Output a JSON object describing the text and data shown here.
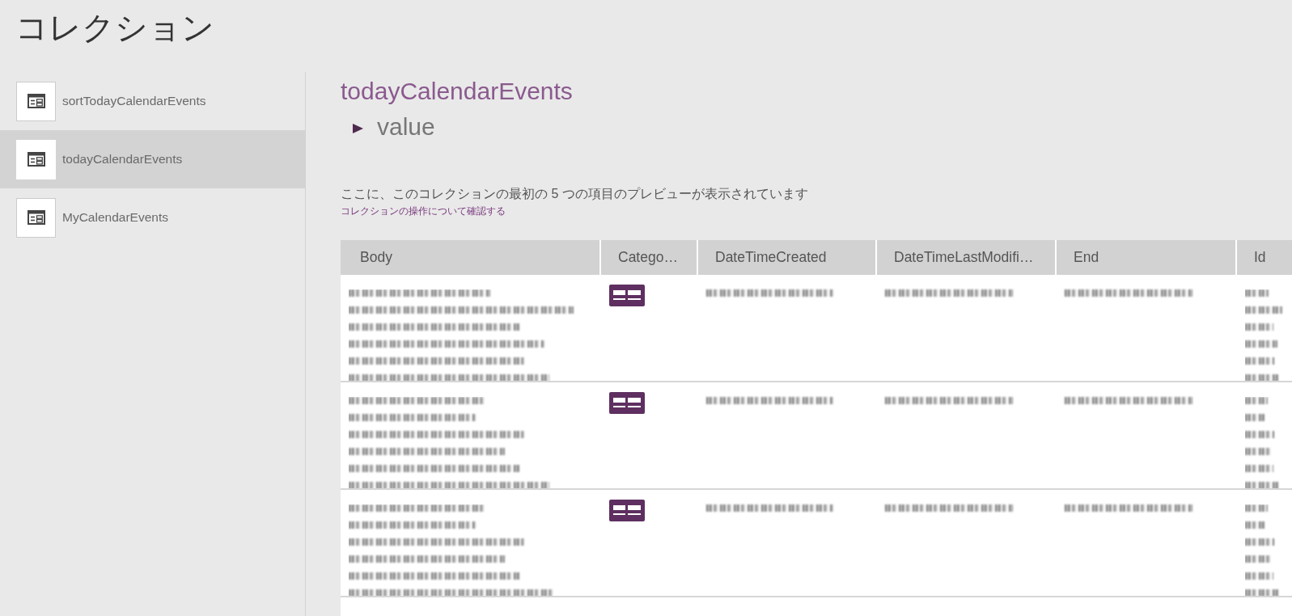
{
  "page_title": "コレクション",
  "sidebar": {
    "items": [
      {
        "label": "sortTodayCalendarEvents",
        "selected": false
      },
      {
        "label": "todayCalendarEvents",
        "selected": true
      },
      {
        "label": "MyCalendarEvents",
        "selected": false
      }
    ]
  },
  "collection": {
    "title": "todayCalendarEvents",
    "tree": [
      {
        "label": "value",
        "expanded": false
      }
    ],
    "description": "ここに、このコレクションの最初の 5 つの項目のプレビューが表示されています",
    "link": "コレクションの操作について確認する"
  },
  "table": {
    "columns": [
      {
        "label": "Body"
      },
      {
        "label": "Catego…"
      },
      {
        "label": "DateTimeCreated"
      },
      {
        "label": "DateTimeLastModifi…"
      },
      {
        "label": "End"
      },
      {
        "label": "Id"
      }
    ],
    "rows": [
      {
        "cells": [
          {
            "kind": "blurred_paragraph"
          },
          {
            "kind": "icon"
          },
          {
            "kind": "blurred_line"
          },
          {
            "kind": "blurred_line"
          },
          {
            "kind": "blurred_line"
          },
          {
            "kind": "blurred_paragraph"
          }
        ]
      },
      {
        "cells": [
          {
            "kind": "blurred_paragraph"
          },
          {
            "kind": "icon"
          },
          {
            "kind": "blurred_line"
          },
          {
            "kind": "blurred_line"
          },
          {
            "kind": "blurred_line"
          },
          {
            "kind": "blurred_paragraph"
          }
        ]
      },
      {
        "cells": [
          {
            "kind": "blurred_paragraph"
          },
          {
            "kind": "icon"
          },
          {
            "kind": "blurred_line"
          },
          {
            "kind": "blurred_line"
          },
          {
            "kind": "blurred_line"
          },
          {
            "kind": "blurred_paragraph"
          }
        ]
      }
    ]
  }
}
